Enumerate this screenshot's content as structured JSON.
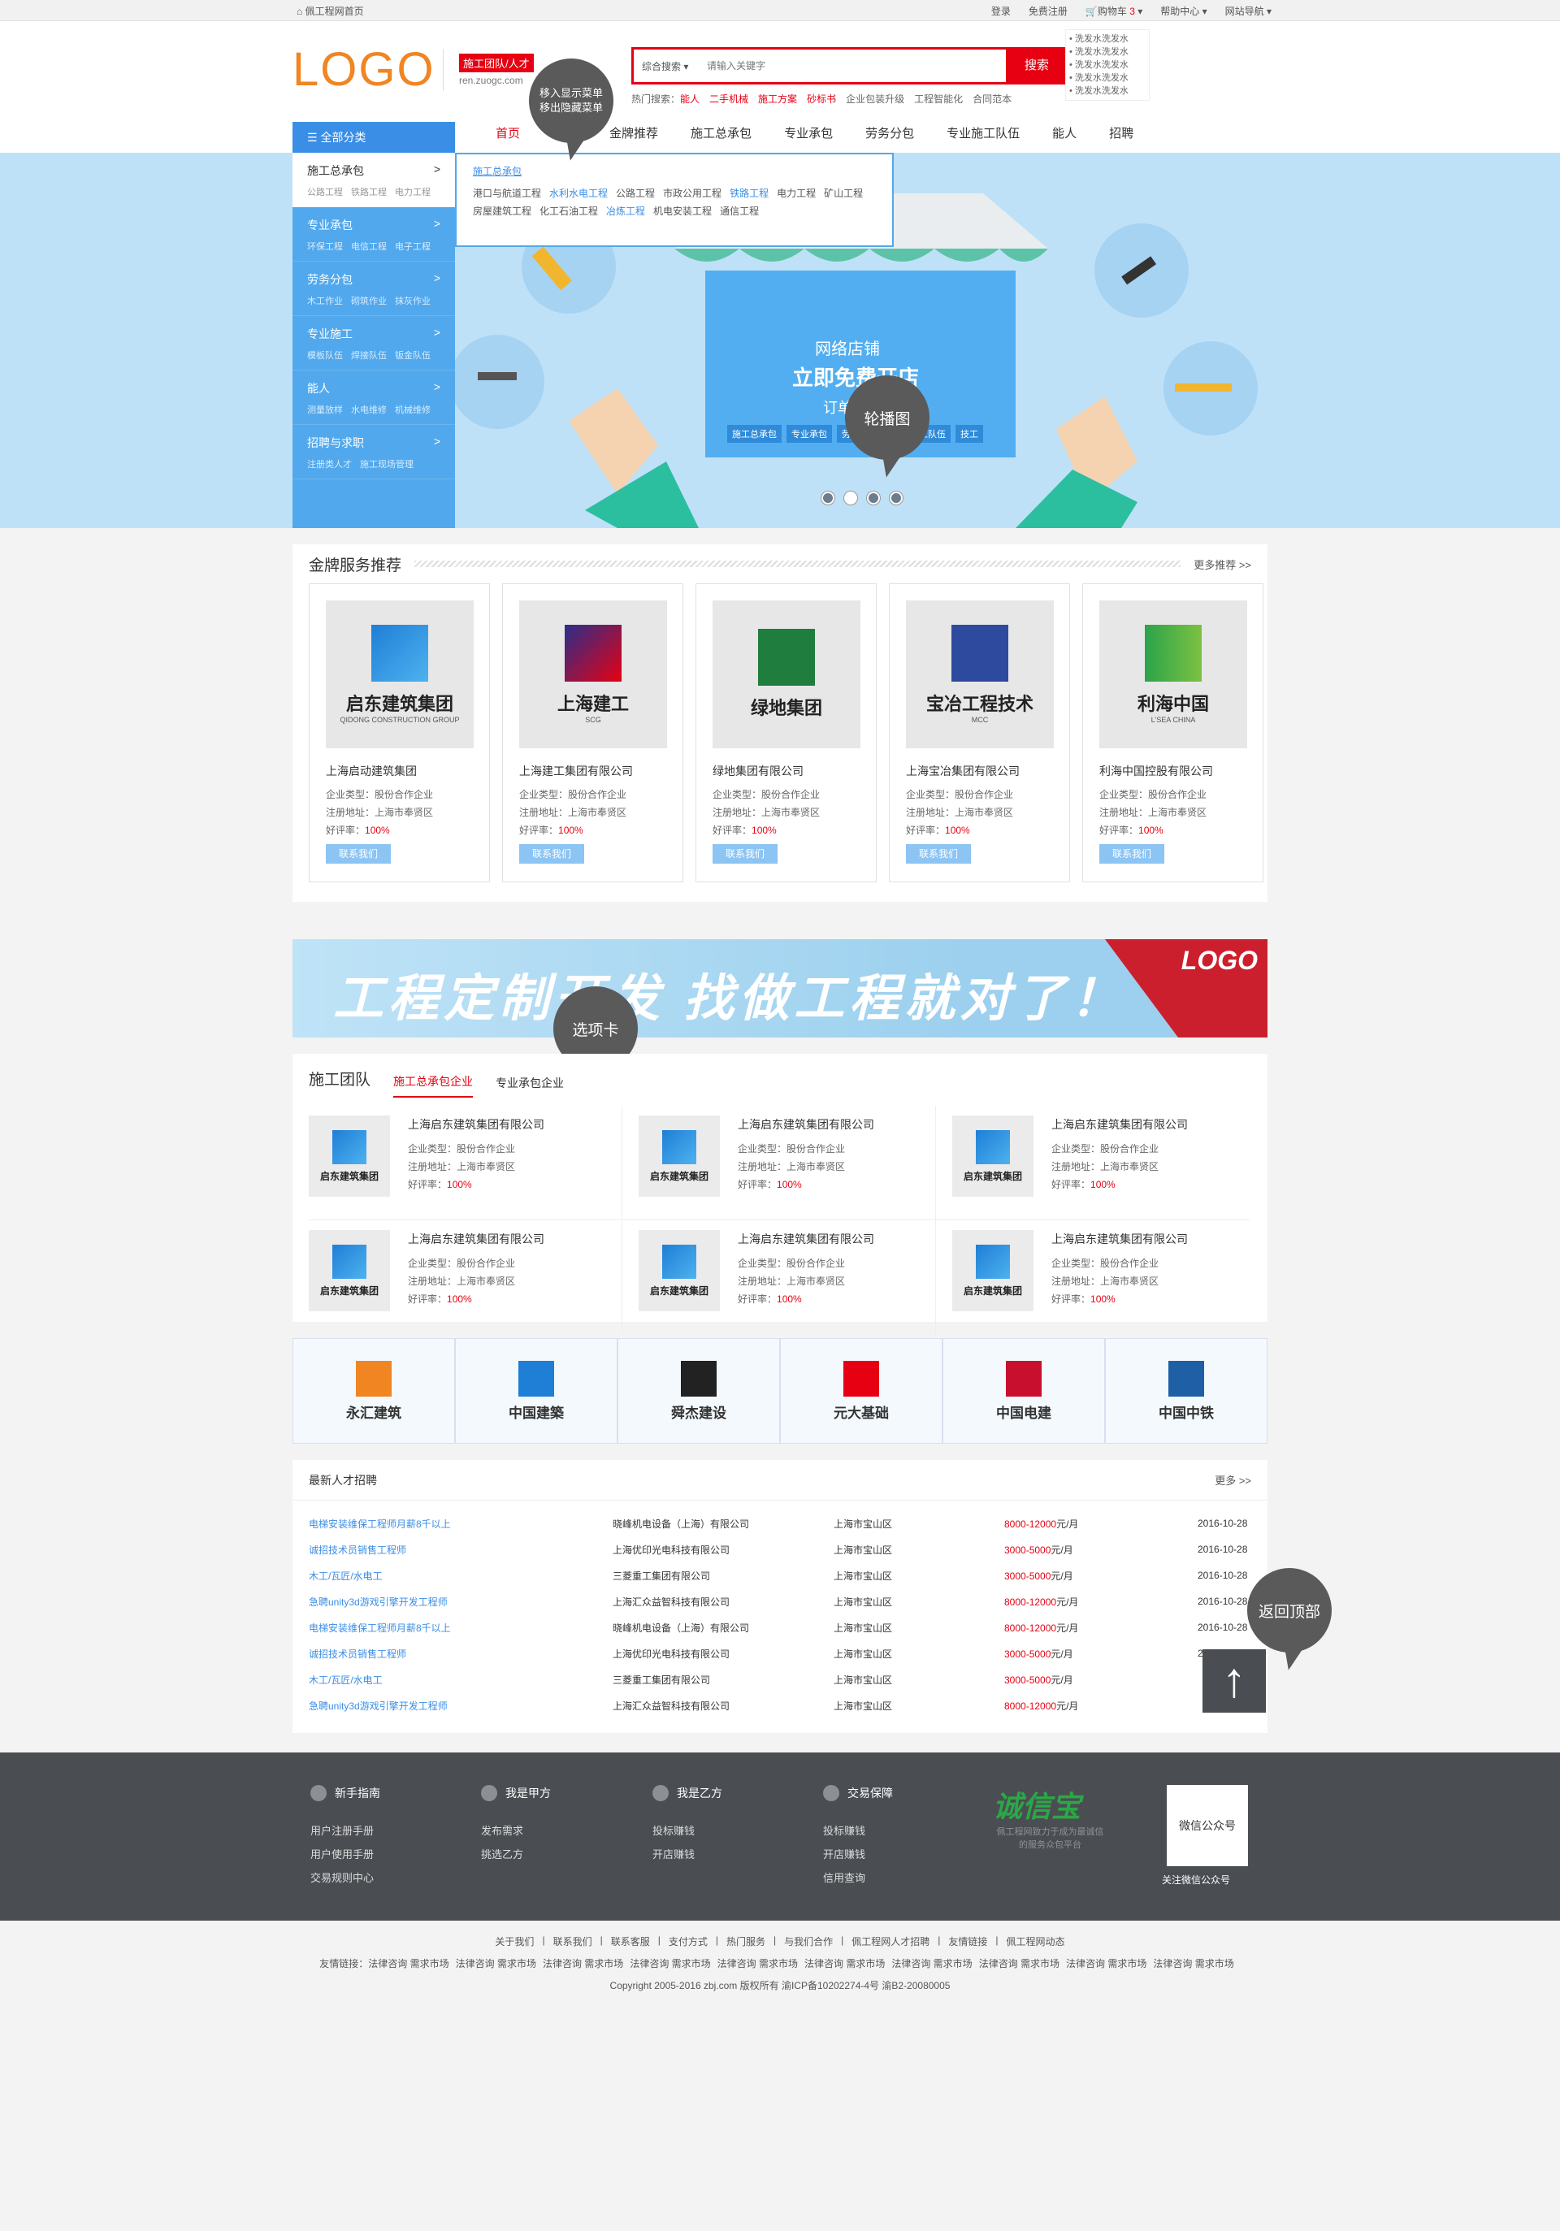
{
  "topbar": {
    "home": "佩工程网首页",
    "login": "登录",
    "register": "免费注册",
    "cart": "购物车",
    "cart_count": "3",
    "help": "帮助中心",
    "sitenav": "网站导航"
  },
  "header": {
    "logo": "LOGO",
    "tag": "施工团队/人才",
    "domain": "ren.zuogc.com",
    "search_scope": "综合搜索",
    "search_placeholder": "请输入关键字",
    "search_button": "搜索",
    "hot_label": "热门搜索：",
    "hot": [
      {
        "t": "能人",
        "red": true
      },
      {
        "t": "二手机械",
        "red": true
      },
      {
        "t": "施工方案",
        "red": true
      },
      {
        "t": "砂标书",
        "red": true
      },
      {
        "t": "企业包装升级",
        "red": false
      },
      {
        "t": "工程智能化",
        "red": false
      },
      {
        "t": "合同范本",
        "red": false
      }
    ],
    "ads": [
      "洗发水洗发水",
      "洗发水洗发水",
      "洗发水洗发水",
      "洗发水洗发水",
      "洗发水洗发水"
    ]
  },
  "nav": {
    "category": "全部分类",
    "items": [
      "首页",
      "品牌",
      "金牌推荐",
      "施工总承包",
      "专业承包",
      "劳务分包",
      "专业施工队伍",
      "能人",
      "招聘"
    ]
  },
  "sidemenu": [
    {
      "t": "施工总承包",
      "s": [
        "公路工程",
        "铁路工程",
        "电力工程"
      ]
    },
    {
      "t": "专业承包",
      "s": [
        "环保工程",
        "电信工程",
        "电子工程"
      ]
    },
    {
      "t": "劳务分包",
      "s": [
        "木工作业",
        "砌筑作业",
        "抹灰作业"
      ]
    },
    {
      "t": "专业施工",
      "s": [
        "模板队伍",
        "焊接队伍",
        "钣金队伍"
      ]
    },
    {
      "t": "能人",
      "s": [
        "测量放样",
        "水电维修",
        "机械维修"
      ]
    },
    {
      "t": "招聘与求职",
      "s": [
        "注册类人才",
        "施工现场管理"
      ]
    }
  ],
  "submenu": {
    "title": "施工总承包",
    "items": [
      {
        "t": "港口与航道工程",
        "b": false
      },
      {
        "t": "水利水电工程",
        "b": true
      },
      {
        "t": "公路工程",
        "b": false
      },
      {
        "t": "市政公用工程",
        "b": false
      },
      {
        "t": "铁路工程",
        "b": true
      },
      {
        "t": "电力工程",
        "b": false
      },
      {
        "t": "矿山工程",
        "b": false
      },
      {
        "t": "房屋建筑工程",
        "b": false
      },
      {
        "t": "化工石油工程",
        "b": false
      },
      {
        "t": "冶炼工程",
        "b": true
      },
      {
        "t": "机电安装工程",
        "b": false
      },
      {
        "t": "通信工程",
        "b": false
      }
    ]
  },
  "banner": {
    "shop1": "网络店铺",
    "shop2": "立即免费开店",
    "shop3": "订单",
    "tags": [
      "施工总承包",
      "专业承包",
      "劳务分包",
      "专业施工队伍",
      "技工"
    ]
  },
  "bubbles": {
    "menu1": "移入显示菜单",
    "menu2": "移出隐藏菜单",
    "carousel": "轮播图",
    "tabs": "选项卡",
    "top": "返回顶部"
  },
  "gold": {
    "title": "金牌服务推荐",
    "more": "更多推荐 >>",
    "type_label": "企业类型：",
    "addr_label": "注册地址：",
    "rate_label": "好评率：",
    "btn": "联系我们",
    "cards": [
      {
        "logo": "启东建筑集团",
        "sub": "QIDONG CONSTRUCTION GROUP",
        "name": "上海启动建筑集团",
        "type": "股份合作企业",
        "addr": "上海市奉贤区",
        "rate": "100%"
      },
      {
        "logo": "上海建工",
        "sub": "SCG",
        "name": "上海建工集团有限公司",
        "type": "股份合作企业",
        "addr": "上海市奉贤区",
        "rate": "100%"
      },
      {
        "logo": "绿地集团",
        "sub": "",
        "name": "绿地集团有限公司",
        "type": "股份合作企业",
        "addr": "上海市奉贤区",
        "rate": "100%"
      },
      {
        "logo": "宝冶工程技术",
        "sub": "MCC",
        "name": "上海宝冶集团有限公司",
        "type": "股份合作企业",
        "addr": "上海市奉贤区",
        "rate": "100%"
      },
      {
        "logo": "利海中国",
        "sub": "L'SEA CHINA",
        "name": "利海中国控股有限公司",
        "type": "股份合作企业",
        "addr": "上海市奉贤区",
        "rate": "100%"
      }
    ]
  },
  "ad": {
    "slogan": "工程定制开发  找做工程就对了！",
    "logo": "LOGO"
  },
  "team": {
    "title": "施工团队",
    "tab1": "施工总承包企业",
    "tab2": "专业承包企业",
    "name": "上海启东建筑集团有限公司",
    "logo": "启东建筑集团",
    "type": "股份合作企业",
    "addr": "上海市奉贤区",
    "rate": "100%"
  },
  "partners": [
    "永汇建筑",
    "中国建築",
    "舜杰建设",
    "元大基础",
    "中国电建",
    "中国中铁"
  ],
  "jobs": {
    "title": "最新人才招聘",
    "more": "更多 >>",
    "unit": "元/月",
    "rows": [
      {
        "t": "电梯安装维保工程师月薪8千以上",
        "c": "晓峰机电设备（上海）有限公司",
        "a": "上海市宝山区",
        "s": "8000-12000",
        "d": "2016-10-28"
      },
      {
        "t": "诚招技术员销售工程师",
        "c": "上海优印光电科技有限公司",
        "a": "上海市宝山区",
        "s": "3000-5000",
        "d": "2016-10-28"
      },
      {
        "t": "木工/瓦匠/水电工",
        "c": "三菱重工集团有限公司",
        "a": "上海市宝山区",
        "s": "3000-5000",
        "d": "2016-10-28"
      },
      {
        "t": "急聘unity3d游戏引擎开发工程师",
        "c": "上海汇众益智科技有限公司",
        "a": "上海市宝山区",
        "s": "8000-12000",
        "d": "2016-10-28"
      },
      {
        "t": "电梯安装维保工程师月薪8千以上",
        "c": "晓峰机电设备（上海）有限公司",
        "a": "上海市宝山区",
        "s": "8000-12000",
        "d": "2016-10-28"
      },
      {
        "t": "诚招技术员销售工程师",
        "c": "上海优印光电科技有限公司",
        "a": "上海市宝山区",
        "s": "3000-5000",
        "d": "2016-10-28"
      },
      {
        "t": "木工/瓦匠/水电工",
        "c": "三菱重工集团有限公司",
        "a": "上海市宝山区",
        "s": "3000-5000",
        "d": ""
      },
      {
        "t": "急聘unity3d游戏引擎开发工程师",
        "c": "上海汇众益智科技有限公司",
        "a": "上海市宝山区",
        "s": "8000-12000",
        "d": ""
      }
    ]
  },
  "footer": {
    "cols": [
      {
        "t": "新手指南",
        "l": [
          "用户注册手册",
          "用户使用手册",
          "交易规则中心"
        ]
      },
      {
        "t": "我是甲方",
        "l": [
          "发布需求",
          "挑选乙方"
        ]
      },
      {
        "t": "我是乙方",
        "l": [
          "投标赚钱",
          "开店赚钱"
        ]
      },
      {
        "t": "交易保障",
        "l": [
          "投标赚钱",
          "开店赚钱",
          "信用查询"
        ]
      }
    ],
    "credit": "诚信宝",
    "credit_desc": "佩工程网致力于成为最诚信的服务众包平台",
    "qr": "微信公众号",
    "qr_label": "关注微信公众号"
  },
  "bottom": {
    "links": [
      "关于我们",
      "联系我们",
      "联系客服",
      "支付方式",
      "热门服务",
      "与我们合作",
      "佩工程网人才招聘",
      "友情链接",
      "佩工程网动态"
    ],
    "friends_label": "友情链接：",
    "friend": "法律咨询  需求市场",
    "copyright": "Copyright 2005-2016 zbj.com 版权所有 渝ICP备10202274-4号 渝B2-20080005"
  }
}
